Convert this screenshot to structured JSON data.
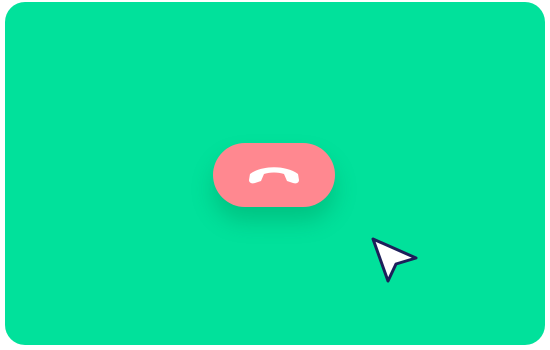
{
  "window": {
    "background_color": "#01e19b"
  },
  "call_controls": {
    "end_call_button": {
      "icon": "phone-hangup-icon",
      "color": "#ff8890",
      "icon_color": "#ffffff"
    }
  },
  "pointer": {
    "icon": "mouse-cursor-icon",
    "fill_color": "#ffffff",
    "outline_color": "#1d1f5a"
  }
}
